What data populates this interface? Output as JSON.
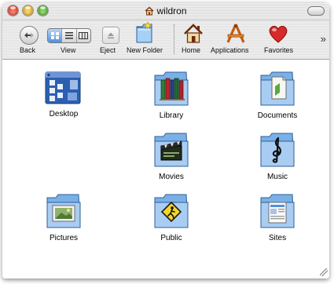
{
  "window": {
    "title": "wildron"
  },
  "toolbar": {
    "back_label": "Back",
    "view_label": "View",
    "eject_label": "Eject",
    "new_folder_label": "New Folder",
    "home_label": "Home",
    "applications_label": "Applications",
    "favorites_label": "Favorites",
    "overflow_label": "»"
  },
  "items": [
    {
      "label": "Desktop",
      "icon": "desktop-folder-icon"
    },
    {
      "label": "Library",
      "icon": "library-folder-icon"
    },
    {
      "label": "Documents",
      "icon": "documents-folder-icon"
    },
    {
      "label": "Movies",
      "icon": "movies-folder-icon"
    },
    {
      "label": "Music",
      "icon": "music-folder-icon"
    },
    {
      "label": "Pictures",
      "icon": "pictures-folder-icon"
    },
    {
      "label": "Public",
      "icon": "public-folder-icon"
    },
    {
      "label": "Sites",
      "icon": "sites-folder-icon"
    }
  ],
  "colors": {
    "folder_blue": "#7ab0e6",
    "selection_blue": "#4f8fe0",
    "favorites_red": "#d72a2a"
  }
}
